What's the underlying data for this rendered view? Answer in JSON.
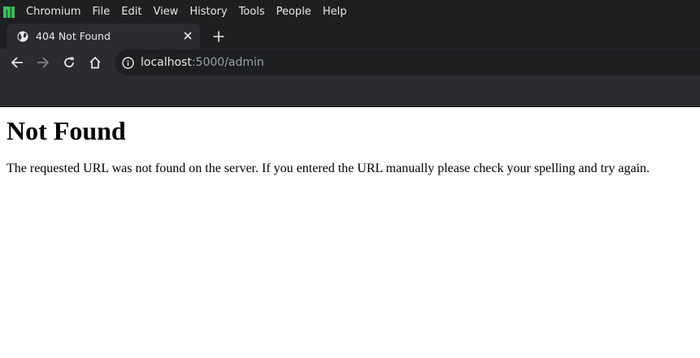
{
  "app": {
    "name": "Chromium",
    "icon": "manjaro-logo-icon",
    "accent": "#35bf5c"
  },
  "menu": [
    "File",
    "Edit",
    "View",
    "History",
    "Tools",
    "People",
    "Help"
  ],
  "tab": {
    "title": "404 Not Found",
    "icon": "globe-icon"
  },
  "address": {
    "host": "localhost",
    "path": ":5000/admin"
  },
  "page": {
    "heading": "Not Found",
    "message": "The requested URL was not found on the server. If you entered the URL manually please check your spelling and try again."
  }
}
